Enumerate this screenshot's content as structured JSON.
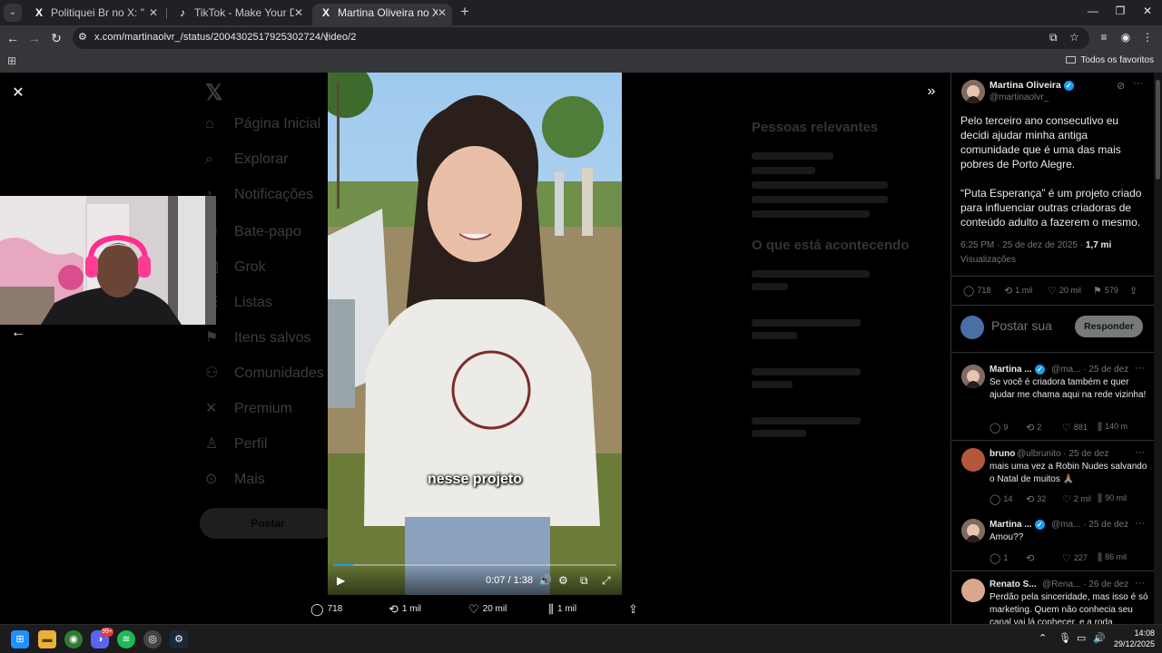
{
  "browser": {
    "tabs": [
      {
        "title": "Politiquei Br no X: \"🔴 ABSURDO",
        "favicon": "X"
      },
      {
        "title": "TikTok - Make Your Day",
        "favicon": "♪"
      },
      {
        "title": "Martina Oliveira no X: \"Pelo terc",
        "favicon": "X",
        "active": true
      }
    ],
    "url": "x.com/martinaolvr_/status/2004302517925302724/video/2",
    "bookmarks_all": "Todos os favoritos"
  },
  "background_nav": [
    "Página Inicial",
    "Explorar",
    "Notificações",
    "Bate-papo",
    "Grok",
    "Listas",
    "Itens salvos",
    "Comunidades",
    "Premium",
    "Perfil",
    "Mais"
  ],
  "background_post_button": "Postar",
  "background_right": {
    "heading1": "Pessoas relevantes",
    "heading2": "O que está acontecendo"
  },
  "video": {
    "subtitle": "nesse projeto",
    "time": "0:07 / 1:38",
    "progress_fraction": 0.072
  },
  "actions": {
    "replies": "718",
    "reposts": "1 mil",
    "likes": "20 mil",
    "views": "1 mil"
  },
  "post": {
    "author": "Martina Oliveira",
    "handle": "@martinaolvr_",
    "text1": "Pelo terceiro ano consecutivo eu decidi ajudar minha antiga comunidade que é uma das mais pobres de Porto Alegre.",
    "text2": "“Puta Esperança” é um projeto criado para influenciar outras criadoras de conteúdo adulto a fazerem o mesmo.",
    "meta_time": "6:25 PM · 25 de dez de 2025 · ",
    "meta_views": "1,7 mi",
    "meta_views_label": "Visualizações",
    "stats": {
      "replies": "718",
      "reposts": "1 mil",
      "likes": "20 mil",
      "bookmarks": "579"
    }
  },
  "reply_box": {
    "placeholder": "Postar sua",
    "button": "Responder"
  },
  "replies": [
    {
      "name": "Martina ...",
      "handle": "@ma...",
      "date": "· 25 de dez",
      "verified": true,
      "text": "Se você é criadora também e quer ajudar me chama aqui na rede vizinha!",
      "stats": {
        "replies": "9",
        "reposts": "2",
        "likes": "881",
        "views": "140 m"
      }
    },
    {
      "name": "bruno",
      "handle": "@ulbrunito",
      "date": "· 25 de dez",
      "verified": false,
      "text": "mais uma vez a Robin Nudes salvando o Natal de muitos 🙏🏽",
      "stats": {
        "replies": "14",
        "reposts": "32",
        "likes": "2 mil",
        "views": "90 mil"
      }
    },
    {
      "name": "Martina ...",
      "handle": "@ma...",
      "date": "· 25 de dez",
      "verified": true,
      "text": "Amou??",
      "stats": {
        "replies": "1",
        "reposts": "",
        "likes": "227",
        "views": "86 mil"
      }
    },
    {
      "name": "Renato S...",
      "handle": "@Rena...",
      "date": "· 26 de dez",
      "verified": false,
      "text": "Perdão pela sinceridade, mas isso é só marketing. Quem não conhecia seu canal vai lá conhecer, e a roda",
      "stats": {}
    }
  ],
  "taskbar": {
    "time": "14:08",
    "date": "29/12/2025",
    "discord_badge": "99+"
  },
  "icons": [
    "x-logo",
    "search-icon",
    "back-arrow-icon",
    "forward-arrow-icon",
    "reload-icon",
    "star-icon",
    "profile-icon",
    "close-icon",
    "expand-icon",
    "play-icon",
    "volume-icon",
    "settings-icon",
    "fullscreen-icon",
    "reply-icon",
    "repost-icon",
    "like-icon",
    "views-icon",
    "share-icon",
    "bookmark-icon",
    "grok-icon",
    "more-icon"
  ]
}
